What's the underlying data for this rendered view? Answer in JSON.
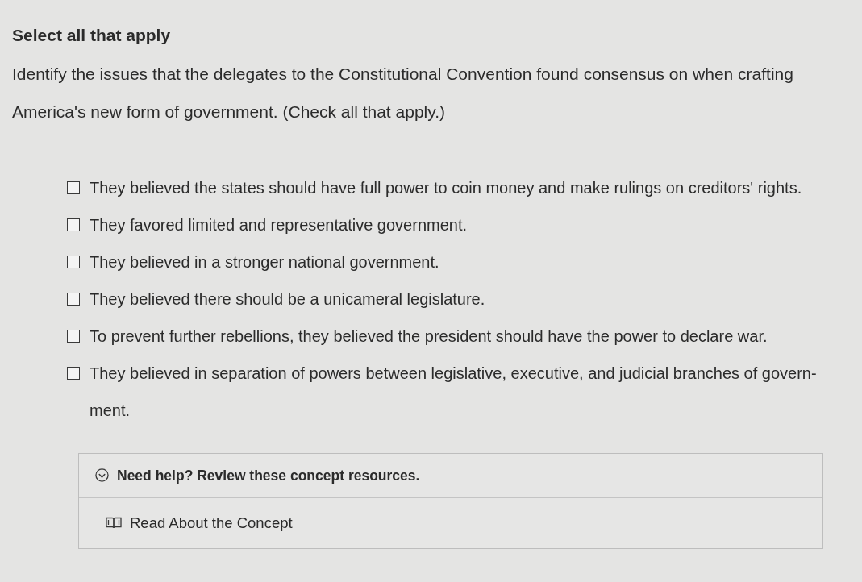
{
  "heading": "Select all that apply",
  "question": "Identify the issues that the delegates to the Constitutional Convention found consensus on when crafting America's new form of government. (Check all that apply.)",
  "options": [
    {
      "label": "They believed the states should have full power to coin money and make rulings on creditors' rights.",
      "checked": false
    },
    {
      "label": "They favored limited and representative government.",
      "checked": false
    },
    {
      "label": "They believed in a stronger national government.",
      "checked": false
    },
    {
      "label": "They believed there should be a unicameral legislature.",
      "checked": false
    },
    {
      "label": "To prevent further rebellions, they believed the president should have the power to declare war.",
      "checked": false
    },
    {
      "label": "They believed in separation of powers between legislative, executive, and judicial branches of govern-ment.",
      "checked": false
    }
  ],
  "help": {
    "title": "Need help? Review these concept resources.",
    "expanded": true,
    "resources": [
      {
        "label": "Read About the Concept"
      }
    ]
  }
}
